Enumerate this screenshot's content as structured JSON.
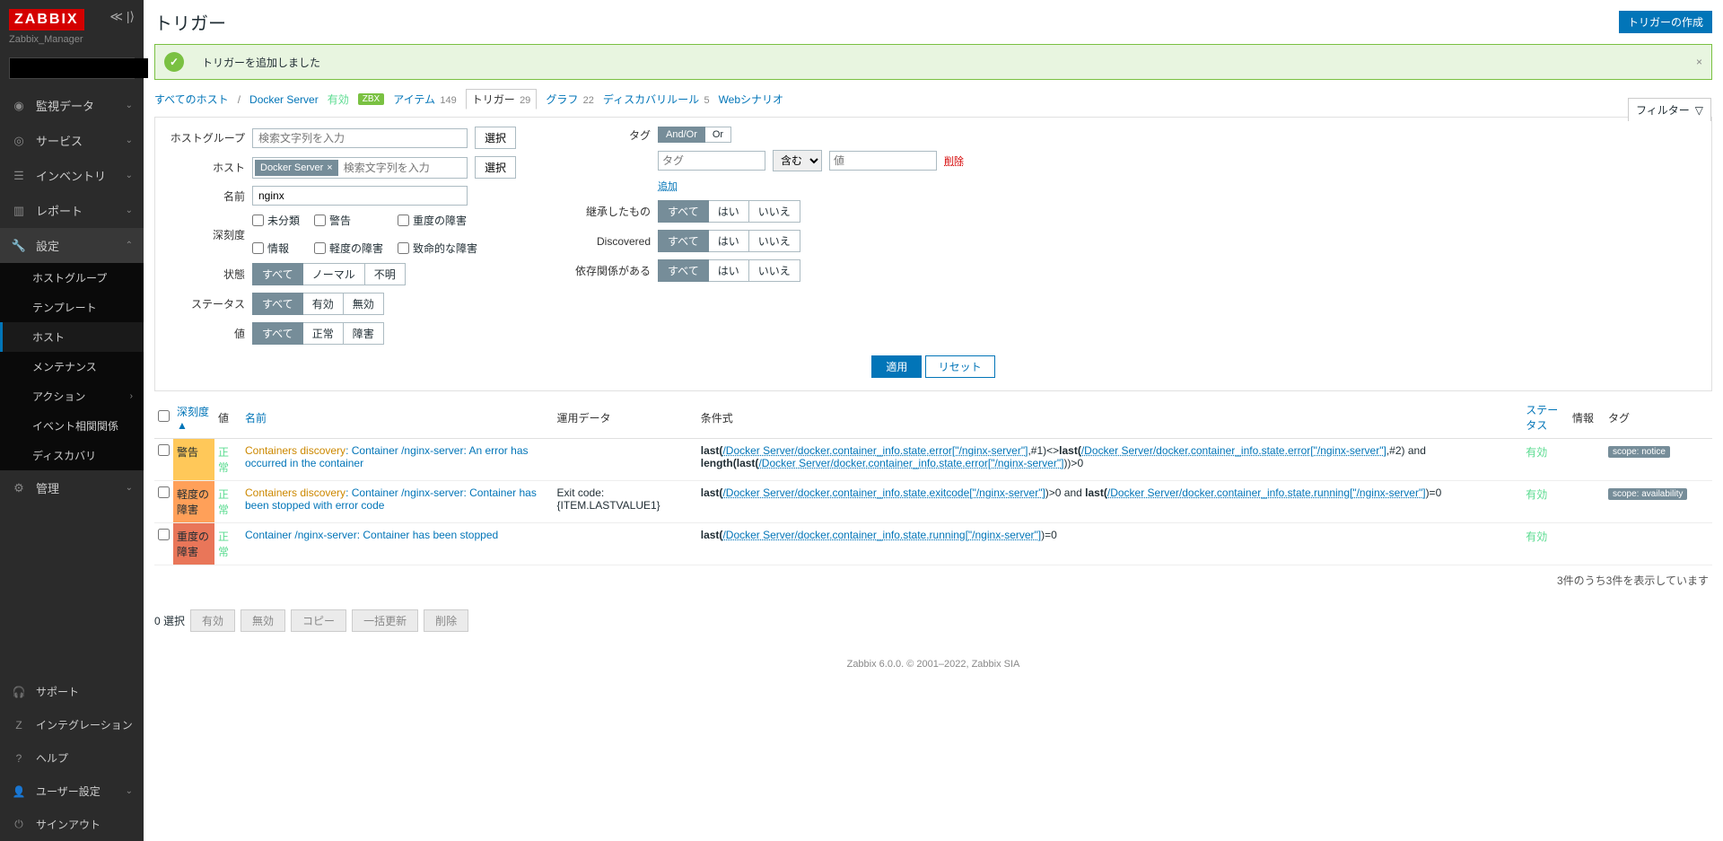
{
  "app": {
    "logo": "ZABBIX",
    "server": "Zabbix_Manager"
  },
  "nav": {
    "monitoring": "監視データ",
    "service": "サービス",
    "inventory": "インベントリ",
    "report": "レポート",
    "setting": "設定",
    "setting_sub": {
      "host_groups": "ホストグループ",
      "templates": "テンプレート",
      "hosts": "ホスト",
      "maintenance": "メンテナンス",
      "actions": "アクション",
      "event_corr": "イベント相関関係",
      "discovery": "ディスカバリ"
    },
    "admin": "管理",
    "footer": {
      "support": "サポート",
      "integration": "インテグレーション",
      "help": "ヘルプ",
      "user": "ユーザー設定",
      "signout": "サインアウト"
    }
  },
  "page": {
    "title": "トリガー",
    "create_btn": "トリガーの作成"
  },
  "message": {
    "text": "トリガーを追加しました"
  },
  "hostbar": {
    "all_hosts": "すべてのホスト",
    "host_name": "Docker Server",
    "enabled": "有効",
    "zbx": "ZBX",
    "items_label": "アイテム",
    "items_count": "149",
    "triggers_label": "トリガー",
    "triggers_count": "29",
    "graphs_label": "グラフ",
    "graphs_count": "22",
    "discovery_label": "ディスカバリルール",
    "discovery_count": "5",
    "web_label": "Webシナリオ",
    "filter_label": "フィルター"
  },
  "filter": {
    "labels": {
      "hostgroup": "ホストグループ",
      "host": "ホスト",
      "name": "名前",
      "severity": "深刻度",
      "state": "状態",
      "status": "ステータス",
      "value": "値",
      "tags": "タグ",
      "inherited": "継承したもの",
      "discovered": "Discovered",
      "depends": "依存関係がある",
      "select": "選択",
      "add": "追加",
      "delete": "削除"
    },
    "placeholders": {
      "search": "検索文字列を入力",
      "tag": "タグ",
      "value": "値"
    },
    "host_chip": "Docker Server",
    "name_value": "nginx",
    "severity_opts": {
      "unclassified": "未分類",
      "info": "情報",
      "warning": "警告",
      "average": "軽度の障害",
      "high": "重度の障害",
      "disaster": "致命的な障害"
    },
    "state_opts": {
      "all": "すべて",
      "normal": "ノーマル",
      "unknown": "不明"
    },
    "status_opts": {
      "all": "すべて",
      "enabled": "有効",
      "disabled": "無効"
    },
    "value_opts": {
      "all": "すべて",
      "ok": "正常",
      "problem": "障害"
    },
    "tag_mode": {
      "andor": "And/Or",
      "or": "Or",
      "contains": "含む"
    },
    "yn": {
      "all": "すべて",
      "yes": "はい",
      "no": "いいえ"
    },
    "actions": {
      "apply": "適用",
      "reset": "リセット"
    }
  },
  "table": {
    "headers": {
      "severity": "深刻度",
      "value": "値",
      "name": "名前",
      "opdata": "運用データ",
      "expression": "条件式",
      "status": "ステータス",
      "info": "情報",
      "tags": "タグ"
    },
    "sort_arrow": "▲",
    "rows": [
      {
        "severity_class": "sev-warn",
        "severity": "警告",
        "value": "正常",
        "prefix": "Containers discovery",
        "name": ": Container /nginx-server: An error has occurred in the container",
        "opdata": "",
        "expr": "last(/Docker Server/docker.container_info.state.error[\"/nginx-server\"],#1)<>last(/Docker Server/docker.container_info.state.error[\"/nginx-server\"],#2) and length(last(/Docker Server/docker.container_info.state.error[\"/nginx-server\"]))>0",
        "status": "有効",
        "tag": "scope: notice"
      },
      {
        "severity_class": "sev-avg",
        "severity": "軽度の障害",
        "value": "正常",
        "prefix": "Containers discovery",
        "name": ": Container /nginx-server: Container has been stopped with error code",
        "opdata": "Exit code: {ITEM.LASTVALUE1}",
        "expr": "last(/Docker Server/docker.container_info.state.exitcode[\"/nginx-server\"])>0 and last(/Docker Server/docker.container_info.state.running[\"/nginx-server\"])=0",
        "status": "有効",
        "tag": "scope: availability"
      },
      {
        "severity_class": "sev-high",
        "severity": "重度の障害",
        "value": "正常",
        "prefix": "",
        "name": "Container /nginx-server: Container has been stopped",
        "opdata": "",
        "expr": "last(/Docker Server/docker.container_info.state.running[\"/nginx-server\"])=0",
        "status": "有効",
        "tag": ""
      }
    ],
    "footer_text": "3件のうち3件を表示しています"
  },
  "bulk": {
    "selected": "0 選択",
    "enable": "有効",
    "disable": "無効",
    "copy": "コピー",
    "massupdate": "一括更新",
    "delete": "削除"
  },
  "footer": "Zabbix 6.0.0. © 2001–2022, Zabbix SIA"
}
